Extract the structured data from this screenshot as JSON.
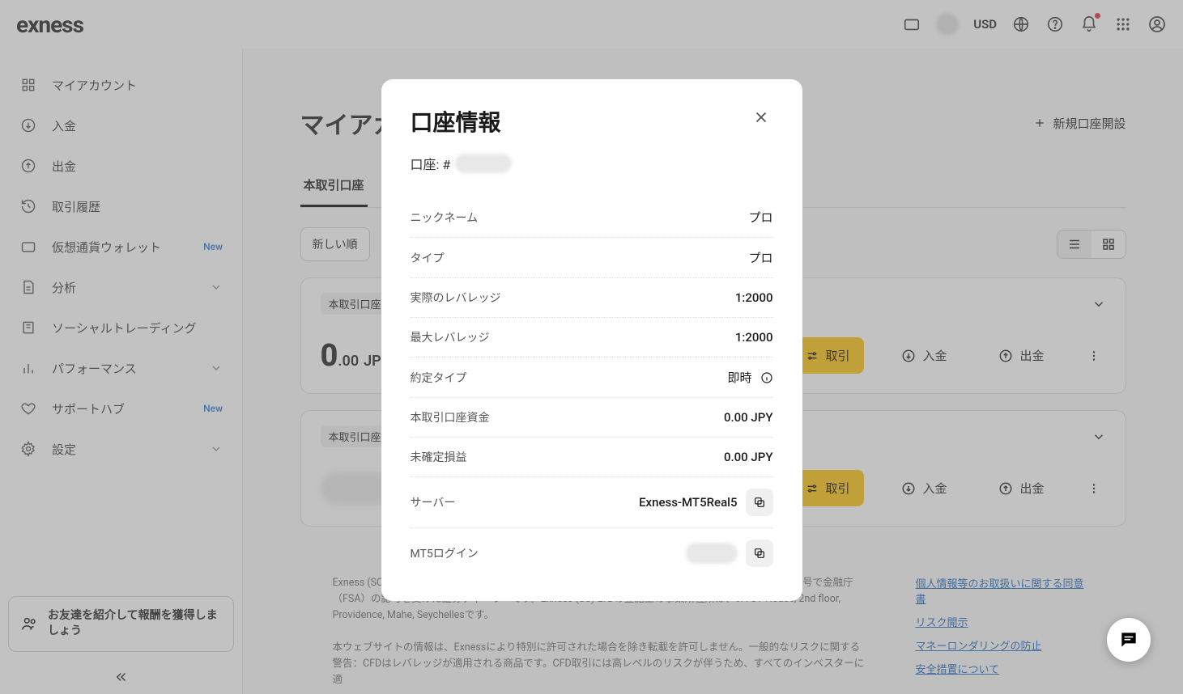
{
  "header": {
    "logo": "exness",
    "currency": "USD"
  },
  "sidebar": {
    "items": [
      {
        "label": "マイアカウント",
        "icon": "grid"
      },
      {
        "label": "入金",
        "icon": "down-circle"
      },
      {
        "label": "出金",
        "icon": "up-circle"
      },
      {
        "label": "取引履歴",
        "icon": "history"
      },
      {
        "label": "仮想通貨ウォレット",
        "icon": "wallet",
        "badge": "New"
      },
      {
        "label": "分析",
        "icon": "file",
        "chev": true
      },
      {
        "label": "ソーシャルトレーディング",
        "icon": "book"
      },
      {
        "label": "パフォーマンス",
        "icon": "bar",
        "chev": true
      },
      {
        "label": "サポートハブ",
        "icon": "heart",
        "badge": "New"
      },
      {
        "label": "設定",
        "icon": "gear",
        "chev": true
      }
    ],
    "referral": "お友達を紹介して報酬を獲得しましょう"
  },
  "main": {
    "title": "マイアカウント",
    "new_account": "新規口座開設",
    "tabs": {
      "real": "本取引口座"
    },
    "sort": "新しい順",
    "cards": [
      {
        "tag": "本取引口座",
        "bal_int": "0",
        "bal_dec": ".00",
        "bal_cur": "JPY"
      },
      {
        "tag": "本取引口座"
      }
    ],
    "actions": {
      "trade": "取引",
      "deposit": "入金",
      "withdraw": "出金"
    }
  },
  "footer": {
    "p1": "Exness (SC) LTDはセイシェル共和国で「8423606-1」の登録番号で登録され、「SD025」のライセンス番号で金融庁（FSA）の認可を受けた証券ディーラーです。Exness (SC) LTDの登記上の事業所住所は、9A CT House, 2nd floor, Providence, Mahe, Seychellesです。",
    "p2": "本ウェブサイトの情報は、Exnessにより特別に許可された場合を除き転載を許可しません。一般的なリスクに関する警告：CFDはレバレッジが適用される商品です。CFD取引には高レベルのリスクが伴うため、すべてのインベスターに適",
    "links": [
      "個人情報等のお取扱いに関する同意書",
      "リスク開示",
      "マネーロンダリングの防止",
      "安全措置について"
    ]
  },
  "modal": {
    "title": "口座情報",
    "account_prefix": "口座: #",
    "rows": {
      "nickname_lbl": "ニックネーム",
      "nickname_val": "プロ",
      "type_lbl": "タイプ",
      "type_val": "プロ",
      "real_lev_lbl": "実際のレバレッジ",
      "real_lev_val": "1:2000",
      "max_lev_lbl": "最大レバレッジ",
      "max_lev_val": "1:2000",
      "exec_lbl": "約定タイプ",
      "exec_val": "即時",
      "funds_lbl": "本取引口座資金",
      "funds_val": "0.00 JPY",
      "pnl_lbl": "未確定損益",
      "pnl_val": "0.00 JPY",
      "server_lbl": "サーバー",
      "server_val": "Exness-MT5Real5",
      "login_lbl": "MT5ログイン"
    }
  }
}
